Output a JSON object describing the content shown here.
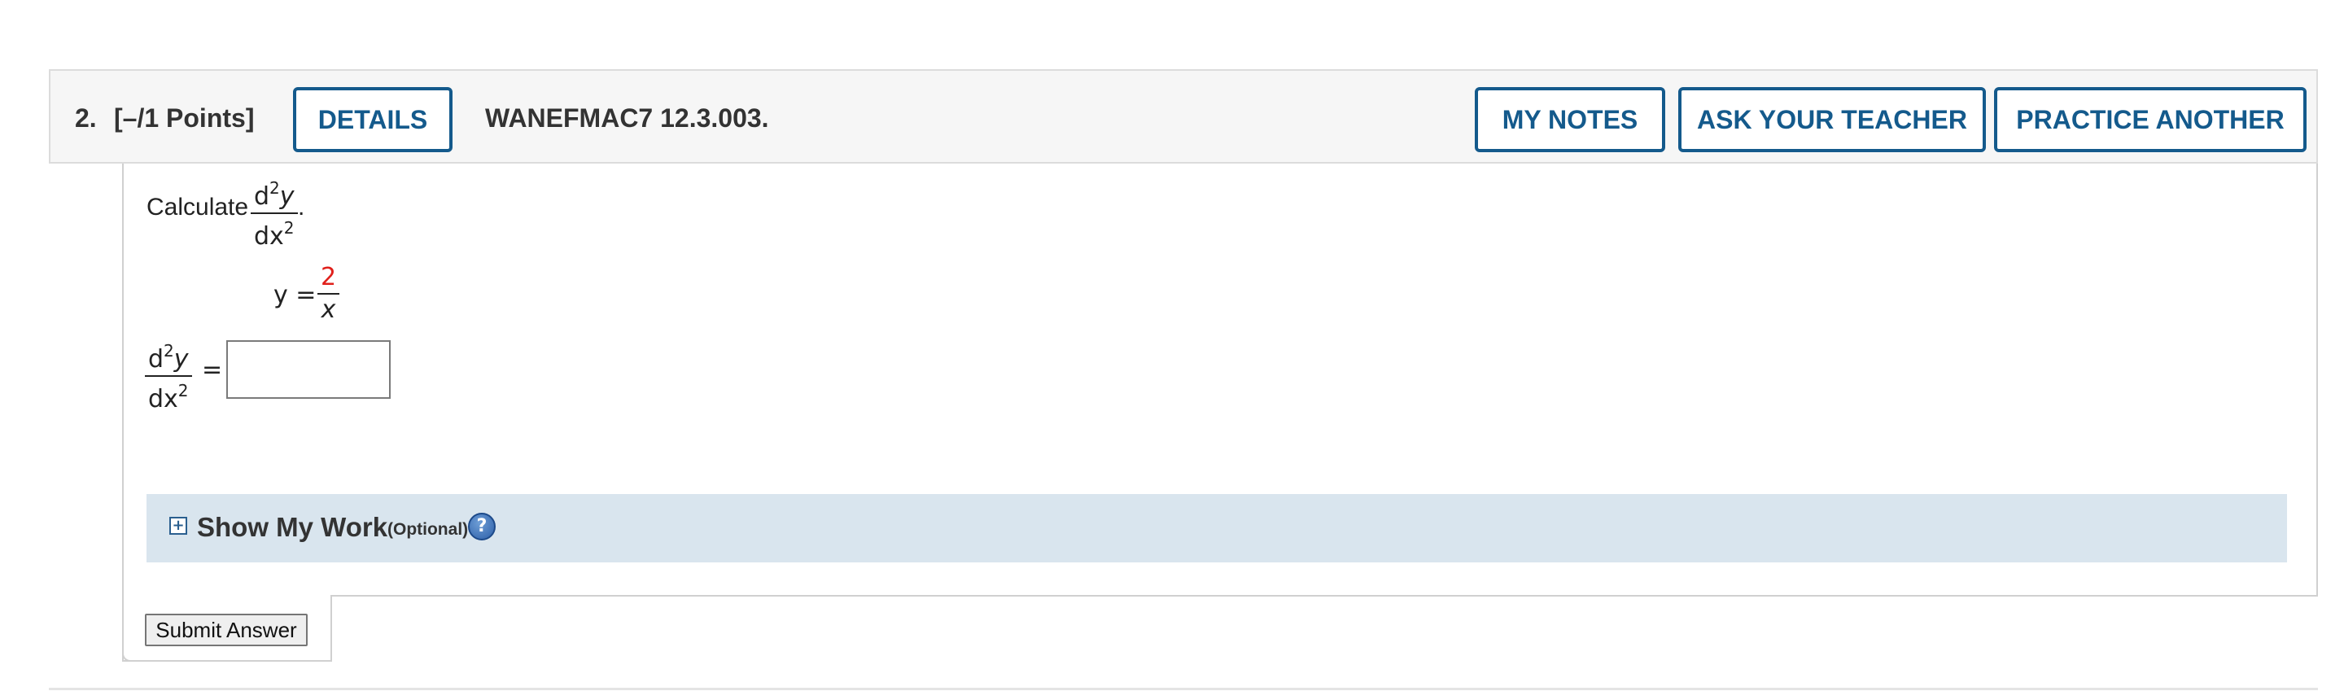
{
  "question": {
    "number": "2.",
    "points": "[–/1 Points]",
    "code": "WANEFMAC7 12.3.003."
  },
  "buttons": {
    "details": "DETAILS",
    "my_notes": "MY NOTES",
    "ask_teacher": "ASK YOUR TEACHER",
    "practice_another": "PRACTICE ANOTHER",
    "submit": "Submit Answer"
  },
  "problem": {
    "prompt_label": "Calculate",
    "derivative_num_base": "d",
    "derivative_num_exp": "2",
    "derivative_num_var": "y",
    "derivative_den_base": "dx",
    "derivative_den_exp": "2",
    "period": ".",
    "function_lhs": "y =",
    "function_num": "2",
    "function_den": "x",
    "answer_eq": "=",
    "answer_value": ""
  },
  "show_my_work": {
    "title": "Show My Work",
    "optional": "(Optional)",
    "expand_symbol": "+",
    "help_symbol": "?"
  },
  "colors": {
    "button_accent": "#145a8c",
    "highlight_number": "#e0201b",
    "show_work_bg": "#d9e5ee"
  }
}
